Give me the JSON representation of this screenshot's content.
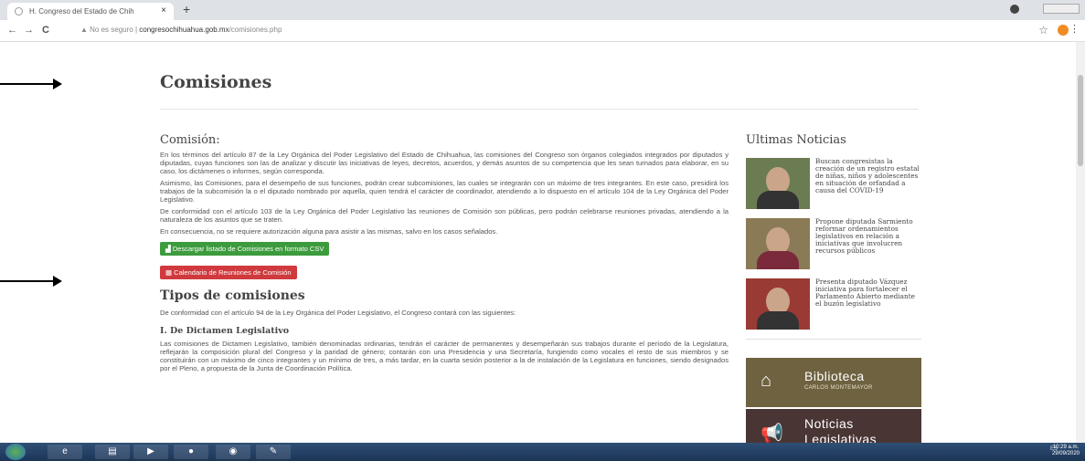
{
  "browser": {
    "tab_title": "H. Congreso del Estado de Chih",
    "tab_close": "×",
    "new_tab": "+",
    "nav_back": "←",
    "nav_forward": "→",
    "nav_reload": "C",
    "security_label": "▲ No es seguro",
    "url_host": "congresochihuahua.gob.mx",
    "url_path": "/comisiones.php",
    "star": "☆",
    "menu": "⋮"
  },
  "page": {
    "title": "Comisiones",
    "comision_heading": "Comisión:",
    "paragraphs": [
      "En los términos del artículo 87 de la Ley Orgánica del Poder Legislativo del Estado de Chihuahua, las comisiones del Congreso son órganos colegiados integrados por diputados y diputadas, cuyas funciones son las de analizar y discutir las iniciativas de leyes, decretos, acuerdos, y demás asuntos de su competencia que les sean turnados para elaborar, en su caso, los dictámenes o informes, según corresponda.",
      "Asimismo, las Comisiones, para el desempeño de sus funciones, podrán crear subcomisiones, las cuales se integrarán con un máximo de tres integrantes. En este caso, presidirá los trabajos de la subcomisión la o el diputado nombrado por aquella, quien tendrá el carácter de coordinador, atendiendo a lo dispuesto en el artículo 104 de la Ley Orgánica del Poder Legislativo.",
      "De conformidad con el artículo 103 de la Ley Orgánica del Poder Legislativo las reuniones de Comisión son públicas, pero podrán celebrarse reuniones privadas, atendiendo a la naturaleza de los asuntos que se traten.",
      "En consecuencia, no se requiere autorización alguna para asistir a las mismas, salvo en los casos señalados."
    ],
    "btn_csv": "Descargar listado de Comisiones en formato CSV",
    "btn_calendar": "Calendario de Reuniones de Comisión",
    "tipos_heading": "Tipos de comisiones",
    "tipos_intro": "De conformidad con el artículo 94 de la Ley Orgánica del Poder Legislativo, el Congreso contará con las siguientes:",
    "dictamen_heading": "I. De Dictamen Legislativo",
    "dictamen_text": "Las comisiones de Dictamen Legislativo, también denominadas ordinarias, tendrán el carácter de permanentes y desempeñarán sus trabajos durante el período de la Legislatura, reflejarán la composición plural del Congreso y la paridad de género; contarán con una Presidencia y una Secretaría, fungiendo como vocales el resto de sus miembros y se constituirán con un máximo de cinco integrantes y un mínimo de tres, a más tardar, en la cuarta sesión posterior a la de instalación de la Legislatura en funciones, siendo designados por el Pleno, a propuesta de la Junta de Coordinación Política."
  },
  "sidebar": {
    "title": "Ultimas Noticias",
    "news": [
      {
        "text": "Buscan congresistas la creación de un registro estatal de niñas, niños y adolescentes en situación de orfandad a causa del COVID-19"
      },
      {
        "text": "Propone diputada Sarmiento reformar ordenamientos legislativos en relación a iniciativas que involucren recursos públicos"
      },
      {
        "text": "Presenta diputado Vázquez iniciativa para fortalecer el Parlamento Abierto mediante el buzón legislativo"
      }
    ],
    "banner_biblioteca": "Biblioteca",
    "banner_biblioteca_sub": "CARLOS MONTEMAYOR",
    "banner_noticias": "Noticias Legislativas"
  },
  "taskbar": {
    "tray": "ES",
    "clock_time": "10:29 a.m.",
    "clock_date": "29/09/2020"
  },
  "colors": {
    "green_button": "#3c9b3c",
    "red_button": "#d0393d",
    "biblioteca_banner": "#6e6240",
    "noticias_banner": "#4a3535"
  }
}
